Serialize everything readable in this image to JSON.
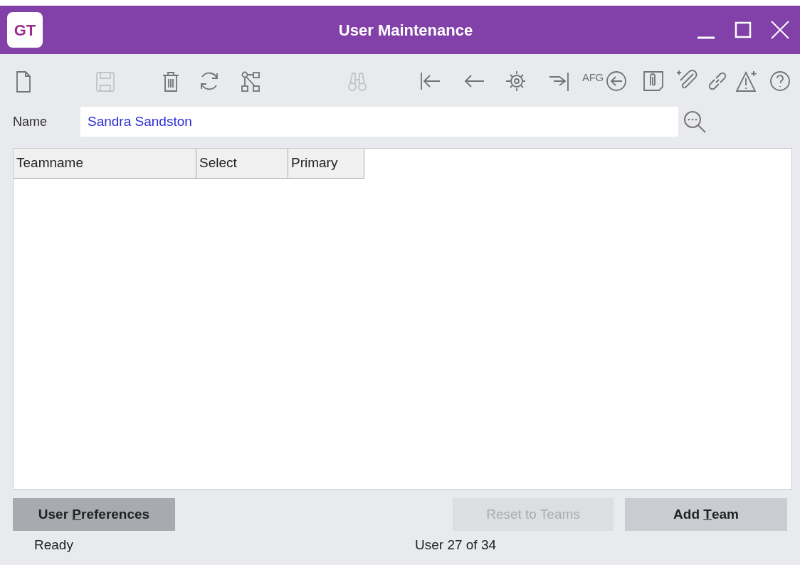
{
  "window": {
    "title": "User Maintenance",
    "logo": "GT"
  },
  "toolbar": [
    {
      "kind": "new",
      "disabled": false
    },
    {
      "kind": "save",
      "disabled": true
    },
    {
      "kind": "delete",
      "disabled": false
    },
    {
      "kind": "refresh",
      "disabled": false
    },
    {
      "kind": "network",
      "disabled": false
    },
    {
      "kind": "find",
      "disabled": true
    },
    {
      "kind": "first",
      "disabled": false
    },
    {
      "kind": "previous",
      "disabled": false
    },
    {
      "kind": "gear",
      "disabled": false
    },
    {
      "kind": "last",
      "disabled": false
    },
    {
      "kind": "text",
      "label": "AFG",
      "disabled": false
    },
    {
      "kind": "circle-back",
      "disabled": false
    },
    {
      "kind": "attachment",
      "disabled": false
    },
    {
      "kind": "add-attachment",
      "disabled": false
    },
    {
      "kind": "link",
      "disabled": false
    },
    {
      "kind": "add-alert",
      "disabled": false
    },
    {
      "kind": "help",
      "disabled": false
    }
  ],
  "name_field": {
    "label": "Name",
    "value": "Sandra Sandston"
  },
  "table": {
    "columns": [
      "Teamname",
      "Select",
      "Primary"
    ]
  },
  "buttons": [
    {
      "before": "User ",
      "access_key": "P",
      "after": "references",
      "disabled": false,
      "kind": "primary"
    },
    {
      "before": "Reset to Teams",
      "disabled": true,
      "kind": "normal"
    },
    {
      "before": "Add ",
      "access_key": "T",
      "after": "eam",
      "disabled": false,
      "kind": "normal"
    }
  ],
  "status_bar": {
    "left": "Ready",
    "center": "User 27 of 34"
  }
}
